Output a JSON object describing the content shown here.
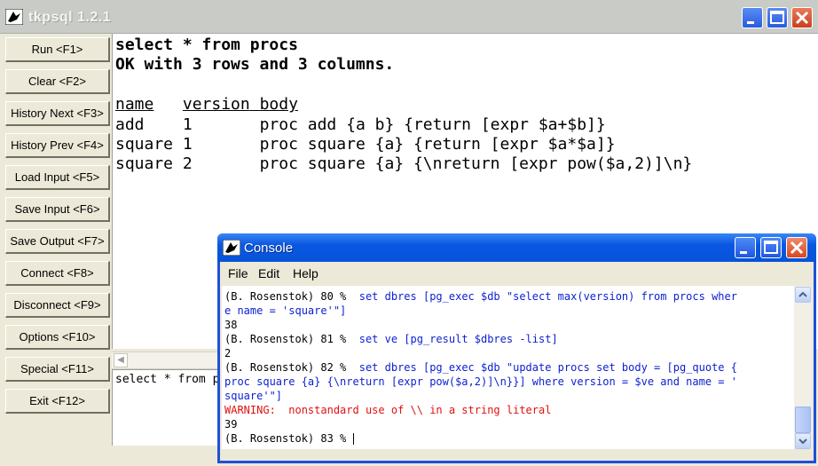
{
  "window": {
    "title": "tkpsql 1.2.1"
  },
  "buttons": [
    {
      "label": "Run <F1>"
    },
    {
      "label": "Clear <F2>"
    },
    {
      "label": "History Next <F3>"
    },
    {
      "label": "History Prev <F4>"
    },
    {
      "label": "Load Input <F5>"
    },
    {
      "label": "Save Input <F6>"
    },
    {
      "label": "Save Output <F7>"
    },
    {
      "label": "Connect <F8>"
    },
    {
      "label": "Disconnect <F9>"
    },
    {
      "label": "Options <F10>"
    },
    {
      "label": "Special <F11>"
    },
    {
      "label": "Exit <F12>"
    }
  ],
  "results": {
    "query": "select * from procs",
    "status": "OK with 3 rows and 3 columns.",
    "columns": [
      "name",
      "version",
      "body"
    ],
    "rows": [
      [
        "add",
        "1",
        "proc add {a b} {return [expr $a+$b]}"
      ],
      [
        "square",
        "1",
        "proc square {a} {return [expr $a*$a]}"
      ],
      [
        "square",
        "2",
        "proc square {a} {\\nreturn [expr pow($a,2)]\\n}"
      ]
    ]
  },
  "input": {
    "text": "select * from p"
  },
  "console": {
    "title": "Console",
    "menu": [
      "File",
      "Edit",
      "Help"
    ],
    "lines": [
      {
        "prompt": "(B. Rosenstok) 80 %  ",
        "cmd": "set dbres [pg_exec $db \"select max(version) from procs wher"
      },
      {
        "cmd": "e name = 'square'\"]"
      },
      {
        "out": "38"
      },
      {
        "prompt": "(B. Rosenstok) 81 %  ",
        "cmd": "set ve [pg_result $dbres -list]"
      },
      {
        "out": "2"
      },
      {
        "prompt": "(B. Rosenstok) 82 %  ",
        "cmd": "set dbres [pg_exec $db \"update procs set body = [pg_quote {"
      },
      {
        "cmd": "proc square {a} {\\nreturn [expr pow($a,2)]\\n}}] where version = $ve and name = '"
      },
      {
        "cmd": "square'\"]"
      },
      {
        "warn": "WARNING:  nonstandard use of \\\\ in a string literal"
      },
      {
        "out": "39"
      },
      {
        "prompt": "(B. Rosenstok) 83 % "
      }
    ]
  },
  "icons": {
    "app": "tk-feather-icon",
    "minimize": "minimize-icon",
    "maximize": "maximize-icon",
    "close": "close-icon"
  },
  "colors": {
    "console_title": "#0553d8",
    "command_text": "#0a1fd0",
    "warning_text": "#e01010"
  }
}
